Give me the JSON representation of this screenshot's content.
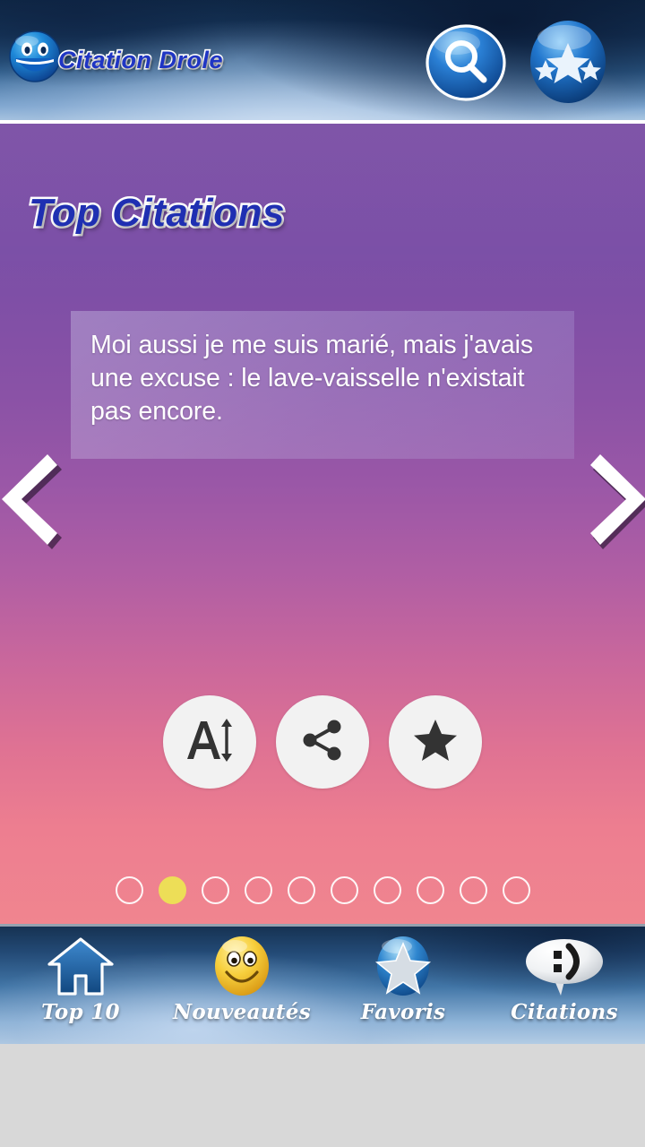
{
  "header": {
    "app_title": "Citation Drole",
    "logo_icon": "blue-smiley-icon",
    "search_icon": "search-icon",
    "top_rated_icon": "three-stars-icon"
  },
  "main": {
    "page_title": "Top Citations",
    "quote": "Moi aussi je me suis marié, mais j'avais une excuse : le lave-vaisselle n'existait pas encore.",
    "prev_icon": "chevron-left-icon",
    "next_icon": "chevron-right-icon",
    "actions": [
      {
        "name": "font-size-button",
        "icon": "font-size-icon"
      },
      {
        "name": "share-button",
        "icon": "share-icon"
      },
      {
        "name": "favorite-button",
        "icon": "star-icon"
      }
    ],
    "pagination": {
      "total": 10,
      "active_index": 1
    }
  },
  "bottom_nav": {
    "items": [
      {
        "label": "Top 10",
        "icon": "home-icon"
      },
      {
        "label": "Nouveautés",
        "icon": "smiley-icon"
      },
      {
        "label": "Favoris",
        "icon": "star-egg-icon"
      },
      {
        "label": "Citations",
        "icon": "speech-bubble-icon"
      }
    ]
  },
  "colors": {
    "header_blue": "#17375c",
    "title_blue": "#1f2fb2",
    "panel_purple": "#7b4fa5",
    "panel_pink": "#f0858f",
    "dot_active": "#edde57",
    "action_bg": "#f2f2f2",
    "footer_gray": "#d8d8d8"
  }
}
